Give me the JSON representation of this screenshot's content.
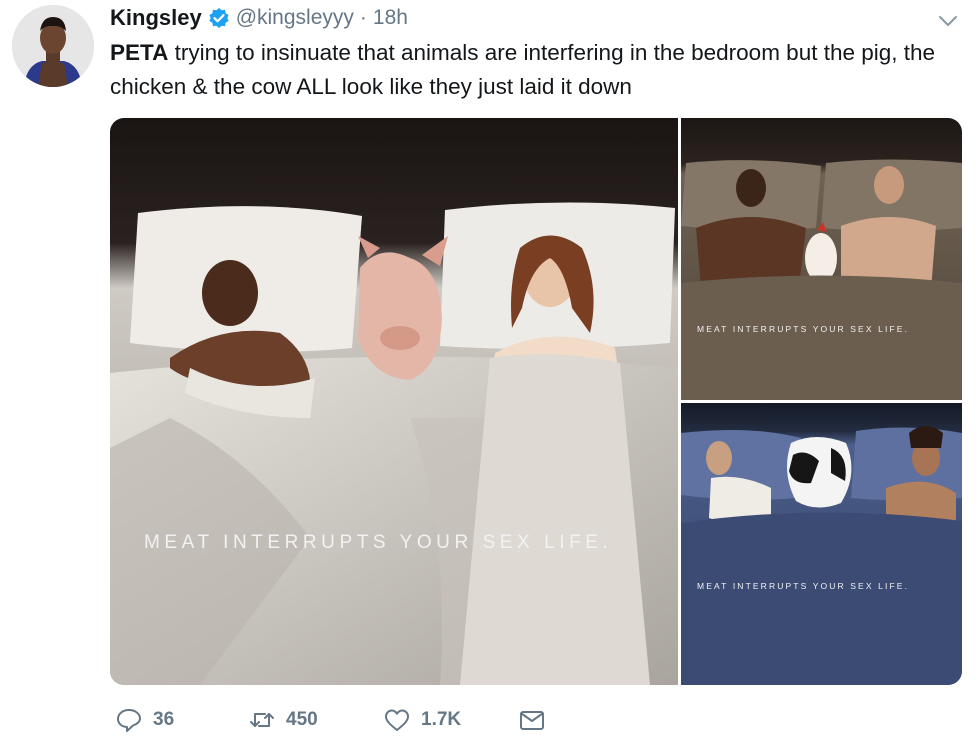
{
  "author": {
    "name": "Kingsley",
    "handle": "@kingsleyyy",
    "separator": "·",
    "time": "18h"
  },
  "tweet": {
    "lead": "PETA",
    "text": " trying to insinuate that animals are interfering in the bedroom but the pig, the chicken & the cow ALL look like they just laid it down"
  },
  "media": {
    "images": [
      {
        "caption": "MEAT INTERRUPTS YOUR SEX LIFE."
      },
      {
        "caption": "MEAT INTERRUPTS YOUR SEX LIFE."
      },
      {
        "caption": "MEAT INTERRUPTS YOUR SEX LIFE."
      }
    ]
  },
  "actions": {
    "replies": "36",
    "retweets": "450",
    "likes": "1.7K"
  },
  "icons": [
    "avatar",
    "verified-badge-icon",
    "chevron-down-icon",
    "reply-icon",
    "retweet-icon",
    "like-icon",
    "direct-message-icon"
  ],
  "colors": {
    "accent": "#1da1f2",
    "secondary_text": "#657786",
    "primary_text": "#14171a"
  }
}
